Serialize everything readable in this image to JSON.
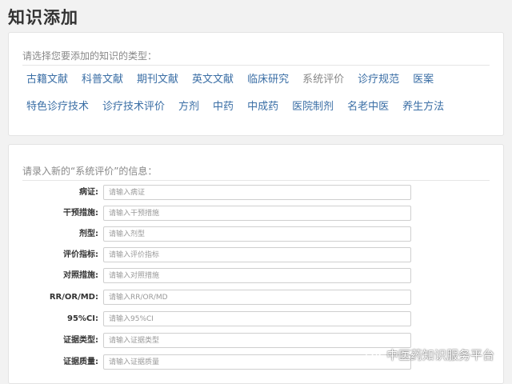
{
  "page": {
    "title": "知识添加"
  },
  "type_selector": {
    "prompt": "请选择您要添加的知识的类型：",
    "types": [
      {
        "label": "古籍文献",
        "active": false
      },
      {
        "label": "科普文献",
        "active": false
      },
      {
        "label": "期刊文献",
        "active": false
      },
      {
        "label": "英文文献",
        "active": false
      },
      {
        "label": "临床研究",
        "active": false
      },
      {
        "label": "系统评价",
        "active": true
      },
      {
        "label": "诊疗规范",
        "active": false
      },
      {
        "label": "医案",
        "active": false
      },
      {
        "label": "特色诊疗技术",
        "active": false
      },
      {
        "label": "诊疗技术评价",
        "active": false
      },
      {
        "label": "方剂",
        "active": false
      },
      {
        "label": "中药",
        "active": false
      },
      {
        "label": "中成药",
        "active": false
      },
      {
        "label": "医院制剂",
        "active": false
      },
      {
        "label": "名老中医",
        "active": false
      },
      {
        "label": "养生方法",
        "active": false
      }
    ]
  },
  "form": {
    "prompt": "请录入新的“系统评价”的信息：",
    "fields": [
      {
        "label": "病证:",
        "placeholder": "请输入病证",
        "value": ""
      },
      {
        "label": "干预措施:",
        "placeholder": "请输入干预措施",
        "value": ""
      },
      {
        "label": "剂型:",
        "placeholder": "请输入剂型",
        "value": ""
      },
      {
        "label": "评价指标:",
        "placeholder": "请输入评价指标",
        "value": ""
      },
      {
        "label": "对照措施:",
        "placeholder": "请输入对照措施",
        "value": ""
      },
      {
        "label": "RR/OR/MD:",
        "placeholder": "请输入RR/OR/MD",
        "value": ""
      },
      {
        "label": "95%CI:",
        "placeholder": "请输入95%CI",
        "value": ""
      },
      {
        "label": "证据类型:",
        "placeholder": "请输入证据类型",
        "value": ""
      },
      {
        "label": "证据质量:",
        "placeholder": "请输入证据质量",
        "value": ""
      }
    ]
  },
  "watermark": {
    "text": "中医药知识服务平台",
    "icon": "wechat-icon"
  },
  "colors": {
    "link": "#3a6ea5",
    "active": "#888888",
    "background": "#f2f2f2"
  }
}
